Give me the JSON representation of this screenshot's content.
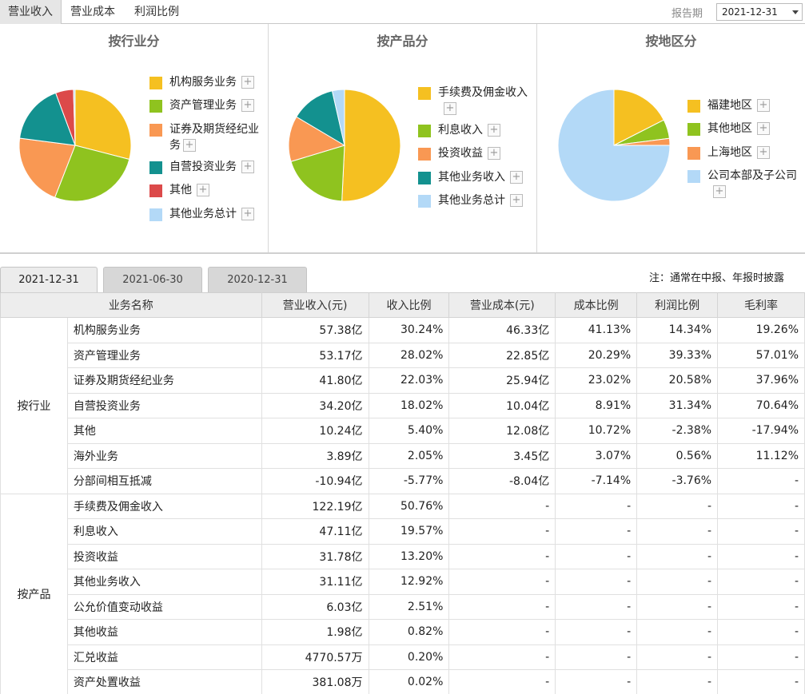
{
  "top_tabs": [
    "营业收入",
    "营业成本",
    "利润比例"
  ],
  "period": {
    "label": "报告期",
    "value": "2021-12-31"
  },
  "panels": [
    {
      "title": "按行业分",
      "legend": [
        {
          "label": "机构服务业务",
          "color": "#f5c021"
        },
        {
          "label": "资产管理业务",
          "color": "#8fc31f"
        },
        {
          "label": "证券及期货经纪业务",
          "color": "#f99853"
        },
        {
          "label": "自营投资业务",
          "color": "#13918f"
        },
        {
          "label": "其他",
          "color": "#dc4a4a"
        },
        {
          "label": "其他业务总计",
          "color": "#b3d9f7"
        }
      ],
      "slices": [
        30.24,
        28.02,
        22.03,
        18.02,
        5.4,
        0.5
      ]
    },
    {
      "title": "按产品分",
      "legend": [
        {
          "label": "手续费及佣金收入",
          "color": "#f5c021"
        },
        {
          "label": "利息收入",
          "color": "#8fc31f"
        },
        {
          "label": "投资收益",
          "color": "#f99853"
        },
        {
          "label": "其他业务收入",
          "color": "#13918f"
        },
        {
          "label": "其他业务总计",
          "color": "#b3d9f7"
        }
      ],
      "slices": [
        50.76,
        19.57,
        13.2,
        12.92,
        3.55
      ]
    },
    {
      "title": "按地区分",
      "legend": [
        {
          "label": "福建地区",
          "color": "#f5c021"
        },
        {
          "label": "其他地区",
          "color": "#8fc31f"
        },
        {
          "label": "上海地区",
          "color": "#f99853"
        },
        {
          "label": "公司本部及子公司",
          "color": "#b3d9f7"
        }
      ],
      "slices": [
        17.5,
        5.5,
        2.0,
        75.0
      ]
    }
  ],
  "plus_symbol": "+",
  "date_tabs": [
    "2021-12-31",
    "2021-06-30",
    "2020-12-31"
  ],
  "note": "注：通常在中报、年报时披露",
  "table": {
    "headers": [
      "业务名称",
      "营业收入(元)",
      "收入比例",
      "营业成本(元)",
      "成本比例",
      "利润比例",
      "毛利率"
    ],
    "groups": [
      {
        "name": "按行业",
        "rows": [
          [
            "机构服务业务",
            "57.38亿",
            "30.24%",
            "46.33亿",
            "41.13%",
            "14.34%",
            "19.26%"
          ],
          [
            "资产管理业务",
            "53.17亿",
            "28.02%",
            "22.85亿",
            "20.29%",
            "39.33%",
            "57.01%"
          ],
          [
            "证券及期货经纪业务",
            "41.80亿",
            "22.03%",
            "25.94亿",
            "23.02%",
            "20.58%",
            "37.96%"
          ],
          [
            "自营投资业务",
            "34.20亿",
            "18.02%",
            "10.04亿",
            "8.91%",
            "31.34%",
            "70.64%"
          ],
          [
            "其他",
            "10.24亿",
            "5.40%",
            "12.08亿",
            "10.72%",
            "-2.38%",
            "-17.94%"
          ],
          [
            "海外业务",
            "3.89亿",
            "2.05%",
            "3.45亿",
            "3.07%",
            "0.56%",
            "11.12%"
          ],
          [
            "分部间相互抵减",
            "-10.94亿",
            "-5.77%",
            "-8.04亿",
            "-7.14%",
            "-3.76%",
            "-"
          ]
        ]
      },
      {
        "name": "按产品",
        "rows": [
          [
            "手续费及佣金收入",
            "122.19亿",
            "50.76%",
            "-",
            "-",
            "-",
            "-"
          ],
          [
            "利息收入",
            "47.11亿",
            "19.57%",
            "-",
            "-",
            "-",
            "-"
          ],
          [
            "投资收益",
            "31.78亿",
            "13.20%",
            "-",
            "-",
            "-",
            "-"
          ],
          [
            "其他业务收入",
            "31.11亿",
            "12.92%",
            "-",
            "-",
            "-",
            "-"
          ],
          [
            "公允价值变动收益",
            "6.03亿",
            "2.51%",
            "-",
            "-",
            "-",
            "-"
          ],
          [
            "其他收益",
            "1.98亿",
            "0.82%",
            "-",
            "-",
            "-",
            "-"
          ],
          [
            "汇兑收益",
            "4770.57万",
            "0.20%",
            "-",
            "-",
            "-",
            "-"
          ],
          [
            "资产处置收益",
            "381.08万",
            "0.02%",
            "-",
            "-",
            "-",
            "-"
          ]
        ]
      }
    ]
  }
}
